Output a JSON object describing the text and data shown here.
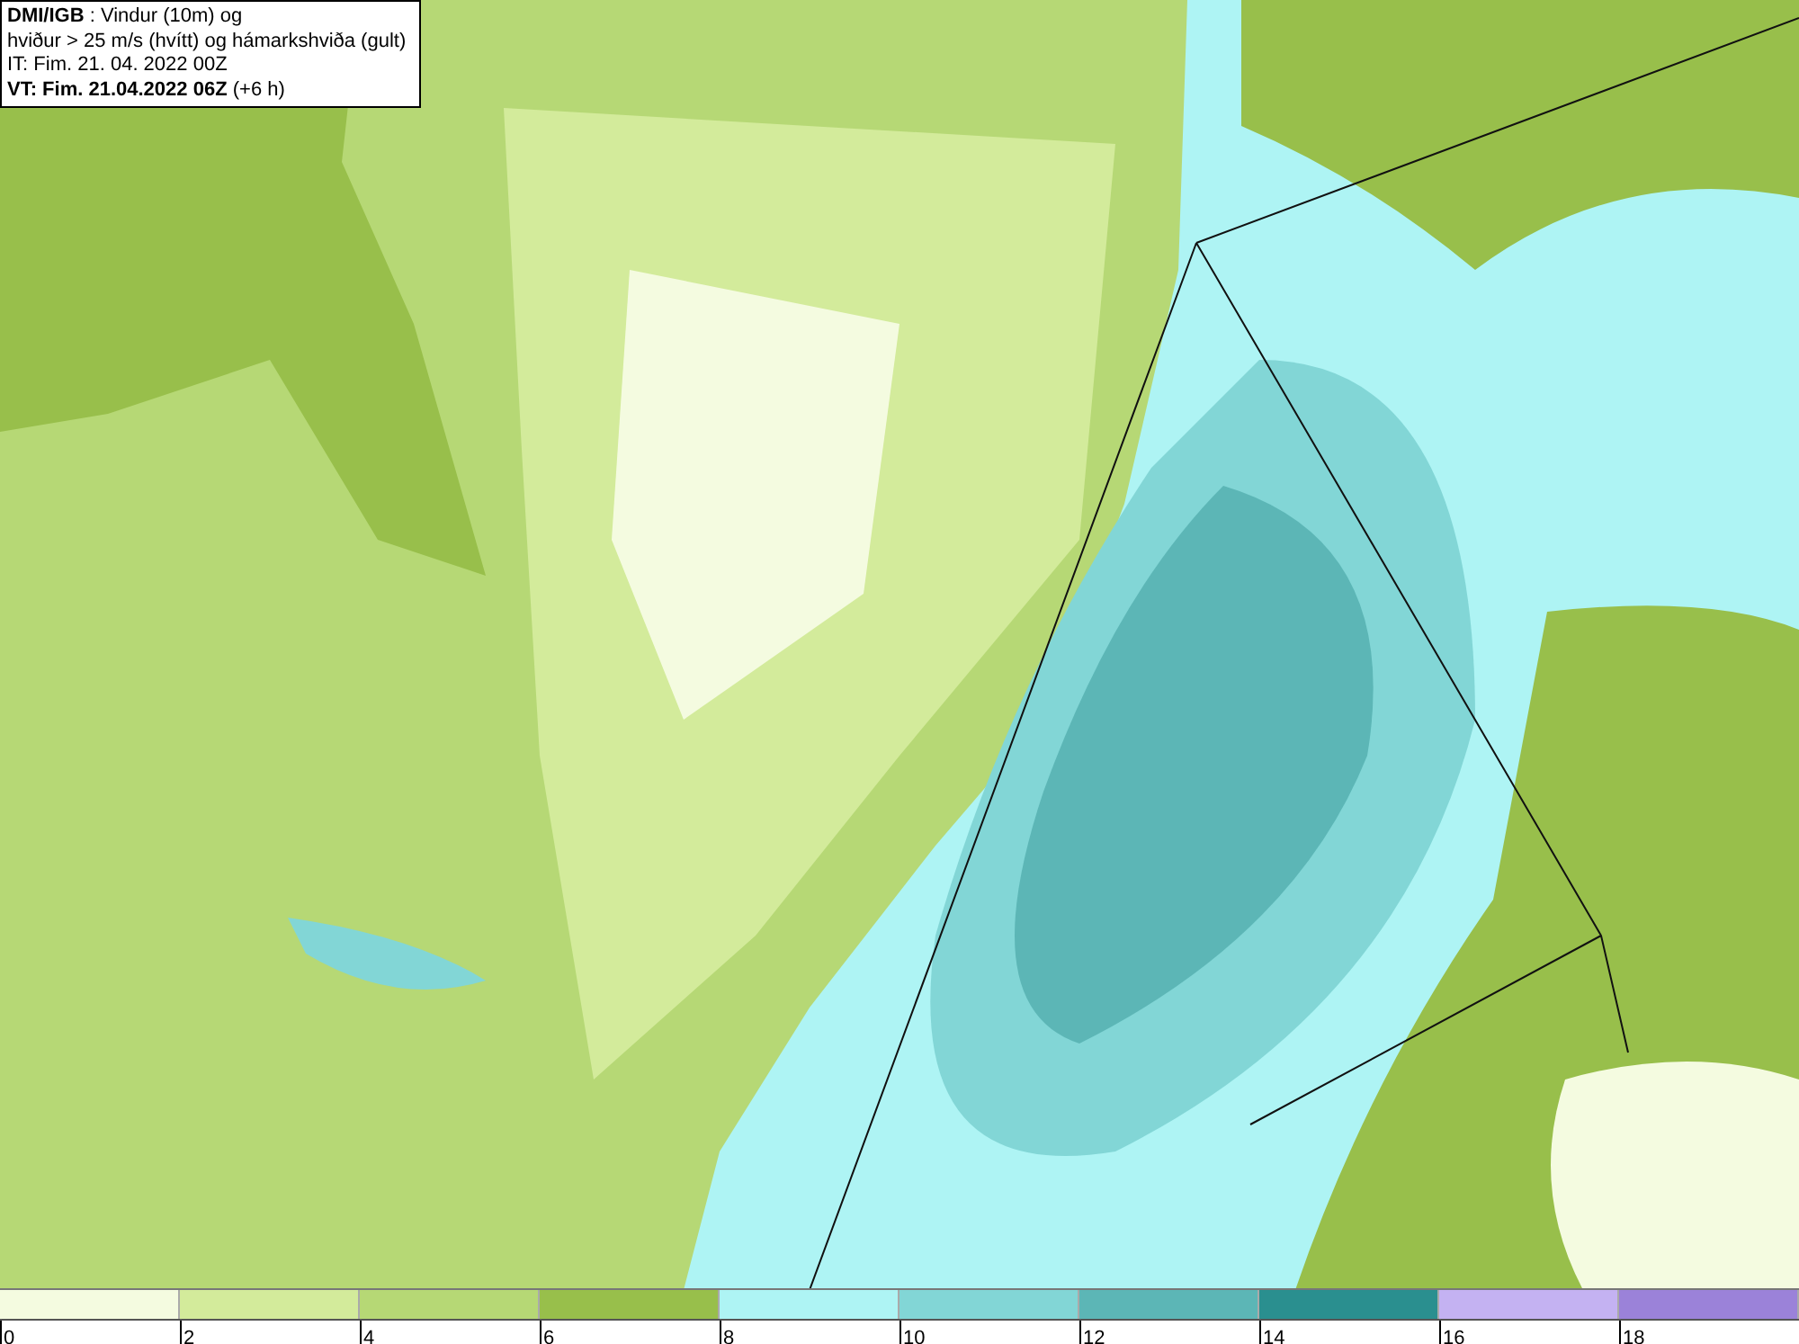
{
  "info_box": {
    "lines": [
      "**DMI/IGB** : Vindur (10m) og",
      "hviður > 25 m/s (hvítt) og hámarkshviða (gult)",
      "IT: Fim. 21. 04. 2022 00Z",
      "**VT: Fim. 21.04.2022 06Z** (+6 h)"
    ]
  },
  "legend": {
    "bins": [
      {
        "color": "#f4fbe0",
        "label": "0"
      },
      {
        "color": "#d3eb9b",
        "label": "2"
      },
      {
        "color": "#b6d875",
        "label": "4"
      },
      {
        "color": "#98bf4b",
        "label": "6"
      },
      {
        "color": "#aef4f4",
        "label": "8"
      },
      {
        "color": "#82d6d6",
        "label": "10"
      },
      {
        "color": "#5cb6b6",
        "label": "12"
      },
      {
        "color": "#2a8f8f",
        "label": "14"
      },
      {
        "color": "#c4b2f2",
        "label": "16"
      },
      {
        "color": "#9b82d9",
        "label": "18"
      }
    ]
  }
}
